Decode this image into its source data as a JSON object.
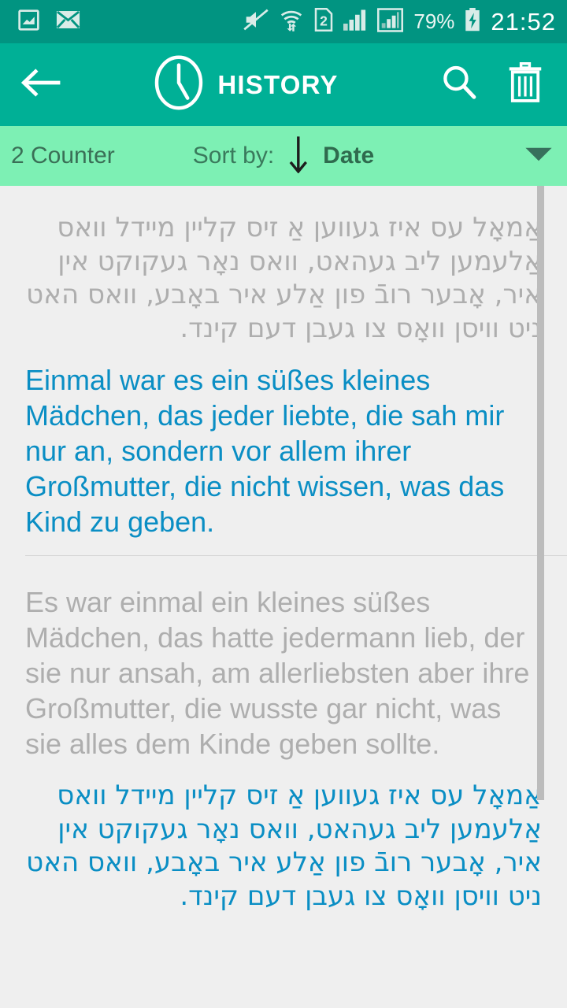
{
  "status_bar": {
    "icons_left": [
      "image-icon",
      "mail-icon"
    ],
    "icons_right": [
      "mute-icon",
      "wifi-icon",
      "sim2-icon",
      "signal-bars-icon",
      "signal-boxed-icon"
    ],
    "battery_percent": "79%",
    "battery_state": "charging",
    "clock": "21:52",
    "background_color": "#019481"
  },
  "app_bar": {
    "back_icon": "arrow-left-icon",
    "clock_icon": "clock-icon",
    "title": "HISTORY",
    "search_icon": "search-icon",
    "delete_icon": "trash-icon",
    "background_color": "#00b096"
  },
  "sort_bar": {
    "counter": "2 Counter",
    "sort_label": "Sort by:",
    "sort_direction_icon": "arrow-down-icon",
    "sort_value": "Date",
    "caret_icon": "triangle-down-icon",
    "background_color": "#7df0b4"
  },
  "entries": [
    {
      "source_text": "אַמאָל עס איז געווען אַ זיס קליין מיידל וואס אַלעמען ליב געהאט, וואס נאָר געקוקט אין איר, אָבער רובֿ פון אַלע איר באָבע, וואס האט ניט וויסן וואָס צו געבן דעם קינד.",
      "source_color": "#aeaeae",
      "target_text": "Einmal war es ein süßes kleines Mädchen, das jeder liebte, die sah mir nur an, sondern vor allem ihrer Großmutter, die nicht wissen, was das Kind zu geben.",
      "target_color": "#0a8ec4"
    },
    {
      "source_text": "Es war einmal ein kleines süßes Mädchen, das hatte jedermann lieb, der sie nur ansah, am allerliebsten aber ihre Großmutter, die wusste gar nicht, was sie alles dem Kinde geben sollte.",
      "source_color": "#aeaeae",
      "target_text": "אַמאָל עס איז געווען אַ זיס קליין מיידל וואס אַלעמען ליב געהאט, וואס נאָר געקוקט אין איר, אָבער רובֿ פון אַלע איר באָבע, וואס האט ניט וויסן וואָס צו געבן דעם קינד.",
      "target_color": "#0a8ec4"
    }
  ],
  "scrollbar": {
    "color": "#bcbcbc"
  }
}
